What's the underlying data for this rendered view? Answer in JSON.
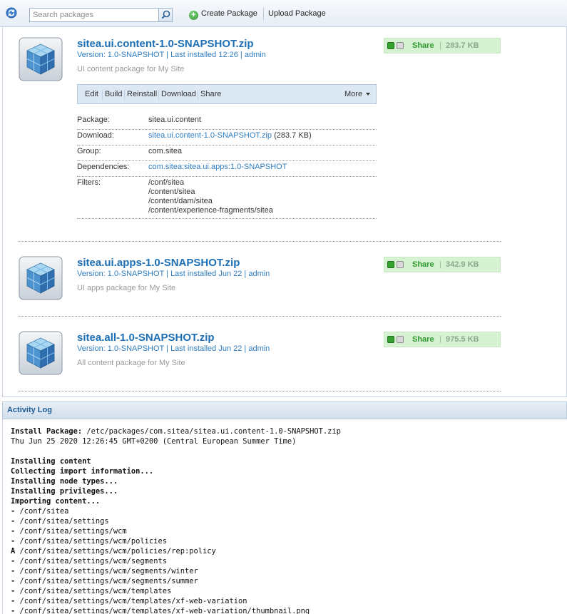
{
  "toolbar": {
    "search_placeholder": "Search packages",
    "create_package": "Create Package",
    "upload_package": "Upload Package"
  },
  "packages": [
    {
      "title": "sitea.ui.content-1.0-SNAPSHOT.zip",
      "version": "Version: 1.0-SNAPSHOT",
      "installed": "Last installed 12:26",
      "user": "admin",
      "description": "UI content package for My Site",
      "share": "Share",
      "size": "283.7 KB",
      "actions": [
        "Edit",
        "Build",
        "Reinstall",
        "Download",
        "Share"
      ],
      "more": "More",
      "details": {
        "package_label": "Package:",
        "package_value": "sitea.ui.content",
        "download_label": "Download:",
        "download_link": "sitea.ui.content-1.0-SNAPSHOT.zip",
        "download_size": "(283.7 KB)",
        "group_label": "Group:",
        "group_value": "com.sitea",
        "dependencies_label": "Dependencies:",
        "dependencies_value": "com.sitea:sitea.ui.apps:1.0-SNAPSHOT",
        "filters_label": "Filters:",
        "filters": [
          "/conf/sitea",
          "/content/sitea",
          "/content/dam/sitea",
          "/content/experience-fragments/sitea"
        ]
      }
    },
    {
      "title": "sitea.ui.apps-1.0-SNAPSHOT.zip",
      "version": "Version: 1.0-SNAPSHOT",
      "installed": "Last installed Jun 22",
      "user": "admin",
      "description": "UI apps package for My Site",
      "share": "Share",
      "size": "342.9 KB"
    },
    {
      "title": "sitea.all-1.0-SNAPSHOT.zip",
      "version": "Version: 1.0-SNAPSHOT",
      "installed": "Last installed Jun 22",
      "user": "admin",
      "description": "All content package for My Site",
      "share": "Share",
      "size": "975.5 KB"
    }
  ],
  "activity_log": {
    "title": "Activity Log",
    "install_label": "Install Package:",
    "install_path": " /etc/packages/com.sitea/sitea.ui.content-1.0-SNAPSHOT.zip",
    "timestamp": "Thu Jun 25 2020 12:26:45 GMT+0200 (Central European Summer Time)",
    "steps": [
      "Installing content",
      "Collecting import information...",
      "Installing node types...",
      "Installing privileges...",
      "Importing content..."
    ],
    "entries": [
      {
        "mark": "-",
        "path": " /conf/sitea"
      },
      {
        "mark": "-",
        "path": " /conf/sitea/settings"
      },
      {
        "mark": "-",
        "path": " /conf/sitea/settings/wcm"
      },
      {
        "mark": "-",
        "path": " /conf/sitea/settings/wcm/policies"
      },
      {
        "mark": "A",
        "path": " /conf/sitea/settings/wcm/policies/rep:policy"
      },
      {
        "mark": "-",
        "path": " /conf/sitea/settings/wcm/segments"
      },
      {
        "mark": "-",
        "path": " /conf/sitea/settings/wcm/segments/winter"
      },
      {
        "mark": "-",
        "path": " /conf/sitea/settings/wcm/segments/summer"
      },
      {
        "mark": "-",
        "path": " /conf/sitea/settings/wcm/templates"
      },
      {
        "mark": "-",
        "path": " /conf/sitea/settings/wcm/templates/xf-web-variation"
      },
      {
        "mark": "-",
        "path": " /conf/sitea/settings/wcm/templates/xf-web-variation/thumbnail.png"
      }
    ],
    "highlight_color": "#e01414"
  }
}
